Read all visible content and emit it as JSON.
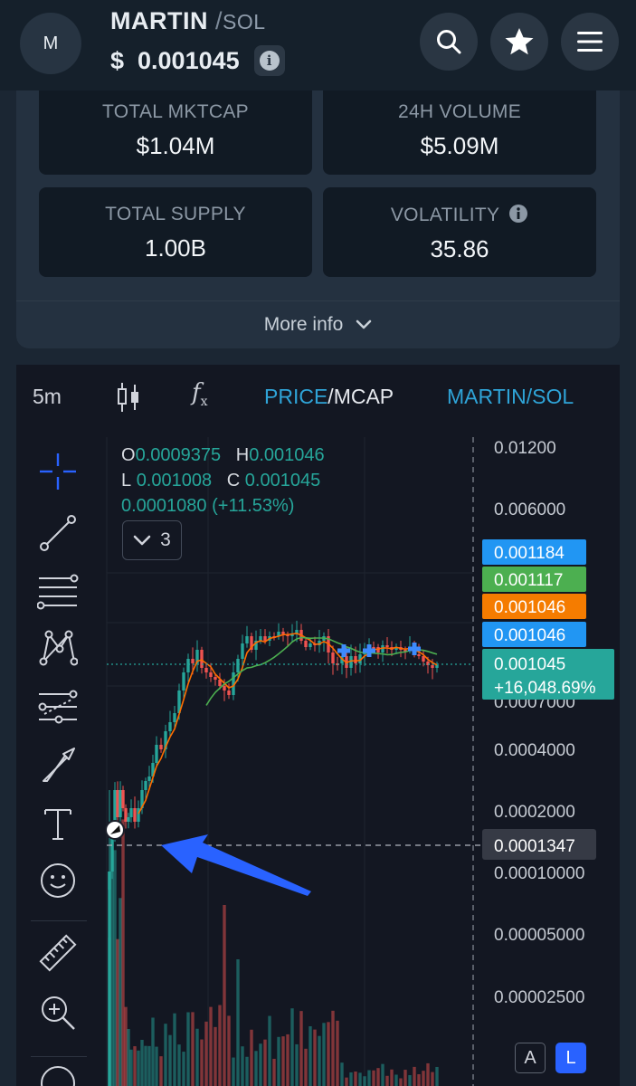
{
  "header": {
    "avatar_letter": "M",
    "token_symbol": "MARTIN",
    "separator": "/",
    "quote_symbol": "SOL",
    "price": "$  0.001045",
    "info_glyph": "i",
    "icons": [
      "search-icon",
      "star-icon",
      "menu-icon"
    ]
  },
  "stats": {
    "total_mktcap": {
      "label": "TOTAL MKTCAP",
      "value": "$1.04M"
    },
    "volume_24h": {
      "label": "24H VOLUME",
      "value": "$5.09M"
    },
    "total_supply": {
      "label": "TOTAL SUPPLY",
      "value": "1.00B"
    },
    "volatility": {
      "label": "VOLATILITY",
      "value": "35.86"
    },
    "more_info": "More info"
  },
  "chart_toolbar": {
    "interval": "5m",
    "price_label": "PRICE",
    "slash": "/",
    "mcap_label": "MCAP",
    "pair_label": "MARTIN/SOL"
  },
  "legend": {
    "o_key": "O",
    "o_val": "0.0009375",
    "h_key": "H",
    "h_val": "0.001046",
    "l_key": "L",
    "l_val": "0.001008",
    "c_key": "C",
    "c_val": "0.001045",
    "change": "0.0001080 (+11.53%)",
    "collapsed_count": "3"
  },
  "price_scale": {
    "ticks": [
      "0.01200",
      "0.006000",
      "0.0004000",
      "0.0002000",
      "0.00010000",
      "0.00005000",
      "0.00002500"
    ],
    "partial_tick": "0.0007000",
    "tags": [
      {
        "text": "0.001184",
        "color": "#2196f3"
      },
      {
        "text": "0.001117",
        "color": "#4caf50"
      },
      {
        "text": "0.001046",
        "color": "#f57c00"
      },
      {
        "text": "0.001046",
        "color": "#2196f3"
      }
    ],
    "last_price": "0.001045",
    "last_change": "+16,048.69%",
    "crosshair_price": "0.0001347",
    "mode_auto": "A",
    "mode_log": "L"
  },
  "colors": {
    "up": "#26a69a",
    "down": "#ef5350",
    "ma_fast": "#ff6d00",
    "ma_slow": "#4caf50",
    "accent": "#2fa4d8",
    "arrow": "#2962ff"
  },
  "chart_data": {
    "type": "candlestick",
    "interval": "5m",
    "scale": "log",
    "ohlc_last": {
      "open": 0.0009375,
      "high": 0.001046,
      "low": 0.001008,
      "close": 0.001045
    },
    "change_abs": 0.000108,
    "change_pct": 11.53,
    "overlay_series": [
      "fast moving average",
      "slow moving average"
    ],
    "annotation": "arrow pointing at 0.0001347"
  }
}
